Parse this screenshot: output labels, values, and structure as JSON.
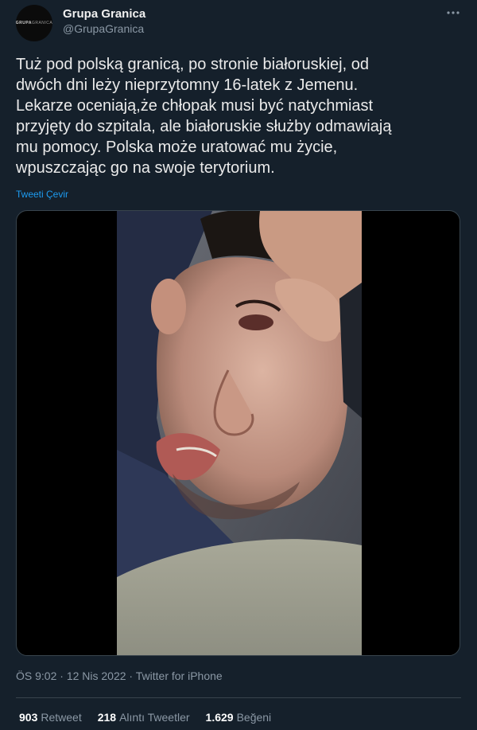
{
  "author": {
    "avatar_text_bold": "GRUPA",
    "avatar_text_thin": "GRANICA",
    "display_name": "Grupa Granica",
    "handle": "@GrupaGranica"
  },
  "tweet": {
    "text": "Tuż pod polską granicą, po stronie białoruskiej, od\ndwóch dni leży nieprzytomny 16-latek z Jemenu.\nLekarze oceniają,że chłopak musi być natychmiast\nprzyjęty do szpitala, ale białoruskie służby odmawiają\nmu pomocy. Polska może uratować mu życie,\nwpuszczając go na swoje terytorium.",
    "translate_label": "Tweeti Çevir",
    "time": "ÖS 9:02",
    "separator": " · ",
    "date": "12 Nis 2022",
    "source": "Twitter for iPhone"
  },
  "stats": {
    "retweets_count": "903",
    "retweets_label": "Retweet",
    "quotes_count": "218",
    "quotes_label": "Alıntı Tweetler",
    "likes_count": "1.629",
    "likes_label": "Beğeni"
  },
  "colors": {
    "background": "#15202b",
    "link": "#1d9bf0",
    "secondary_text": "#8b98a5",
    "border": "#38444d"
  },
  "icons": {
    "more": "more-horizontal-icon"
  }
}
